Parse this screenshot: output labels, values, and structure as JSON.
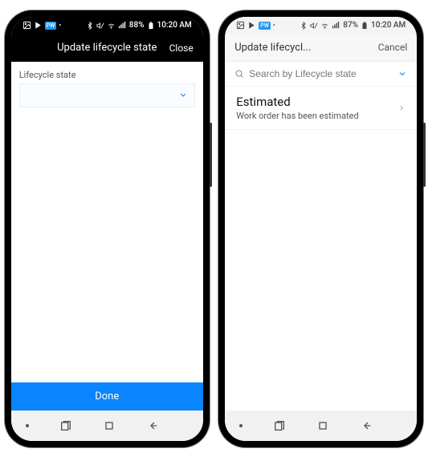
{
  "left": {
    "status": {
      "battery": "88%",
      "time": "10:20 AM"
    },
    "header": {
      "title": "Update lifecycle state",
      "close": "Close"
    },
    "field_label": "Lifecycle state",
    "done": "Done"
  },
  "right": {
    "status": {
      "battery": "87%",
      "time": "10:20 AM"
    },
    "header": {
      "title": "Update lifecycl...",
      "cancel": "Cancel"
    },
    "search_placeholder": "Search by Lifecycle state",
    "item": {
      "title": "Estimated",
      "sub": "Work order has been estimated"
    }
  }
}
